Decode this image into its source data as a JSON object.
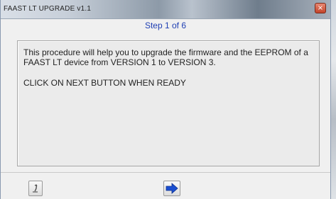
{
  "window": {
    "title": "FAAST LT UPGRADE v1.1",
    "close_glyph": "×"
  },
  "wizard": {
    "step_label": "Step 1 of 6",
    "message_line1": "This procedure will help you to upgrade the firmware and the EEPROM of a FAAST LT device from VERSION 1 to VERSION 3.",
    "message_line2": "CLICK ON NEXT BUTTON WHEN READY"
  },
  "buttons": {
    "exit_icon": "exit-icon",
    "next_icon": "arrow-right-icon"
  },
  "colors": {
    "step_label": "#1f3fb3",
    "next_arrow": "#1b4fd1"
  }
}
